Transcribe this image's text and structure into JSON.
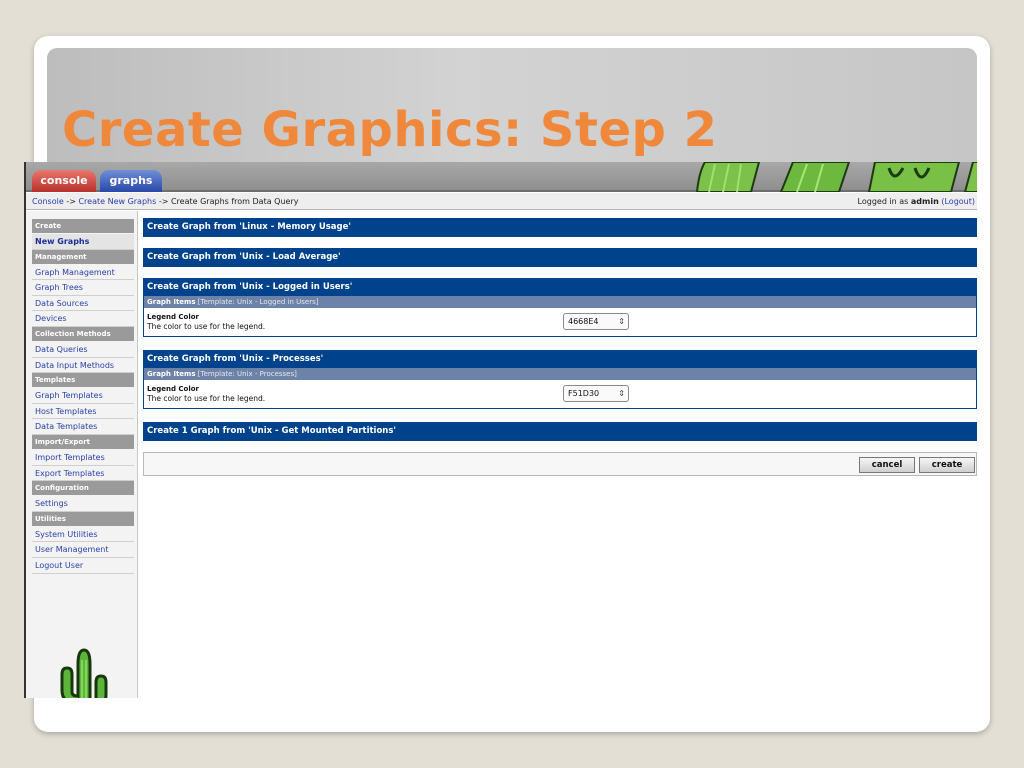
{
  "slide": {
    "title": "Create Graphics: Step 2"
  },
  "tabs": [
    {
      "label": "console"
    },
    {
      "label": "graphs"
    }
  ],
  "breadcrumb": {
    "console": "Console",
    "sep": "->",
    "create_new_graphs": "Create New Graphs",
    "current": "Create Graphs from Data Query"
  },
  "login": {
    "prefix": "Logged in as",
    "user": "admin",
    "logout": "(Logout)"
  },
  "sidebar": {
    "items": [
      {
        "label": "Create",
        "kind": "header"
      },
      {
        "label": "New Graphs",
        "kind": "item",
        "active": true
      },
      {
        "label": "Management",
        "kind": "header"
      },
      {
        "label": "Graph Management",
        "kind": "item"
      },
      {
        "label": "Graph Trees",
        "kind": "item"
      },
      {
        "label": "Data Sources",
        "kind": "item"
      },
      {
        "label": "Devices",
        "kind": "item"
      },
      {
        "label": "Collection Methods",
        "kind": "header"
      },
      {
        "label": "Data Queries",
        "kind": "item"
      },
      {
        "label": "Data Input Methods",
        "kind": "item"
      },
      {
        "label": "Templates",
        "kind": "header"
      },
      {
        "label": "Graph Templates",
        "kind": "item"
      },
      {
        "label": "Host Templates",
        "kind": "item"
      },
      {
        "label": "Data Templates",
        "kind": "item"
      },
      {
        "label": "Import/Export",
        "kind": "header"
      },
      {
        "label": "Import Templates",
        "kind": "item"
      },
      {
        "label": "Export Templates",
        "kind": "item"
      },
      {
        "label": "Configuration",
        "kind": "header"
      },
      {
        "label": "Settings",
        "kind": "item"
      },
      {
        "label": "Utilities",
        "kind": "header"
      },
      {
        "label": "System Utilities",
        "kind": "item"
      },
      {
        "label": "User Management",
        "kind": "item"
      },
      {
        "label": "Logout User",
        "kind": "item"
      }
    ]
  },
  "panels": [
    {
      "title": "Create Graph from 'Linux - Memory Usage'"
    },
    {
      "title": "Create Graph from 'Unix - Load Average'"
    },
    {
      "title": "Create Graph from 'Unix - Logged in Users'",
      "sub_bold": "Graph Items",
      "sub_rest": "[Template: Unix - Logged in Users]",
      "field_title": "Legend Color",
      "field_desc": "The color to use for the legend.",
      "value": "4668E4"
    },
    {
      "title": "Create Graph from 'Unix - Processes'",
      "sub_bold": "Graph Items",
      "sub_rest": "[Template: Unix - Processes]",
      "field_title": "Legend Color",
      "field_desc": "The color to use for the legend.",
      "value": "F51D30"
    },
    {
      "title": "Create 1 Graph from 'Unix - Get Mounted Partitions'"
    }
  ],
  "actions": {
    "cancel": "cancel",
    "create": "create"
  },
  "icons": {
    "select_arrows": "⇕"
  },
  "colors": {
    "header_blue": "#00438c",
    "title_orange": "#f0883c",
    "console_tab": "#b8312b",
    "graphs_tab": "#2848a8"
  }
}
